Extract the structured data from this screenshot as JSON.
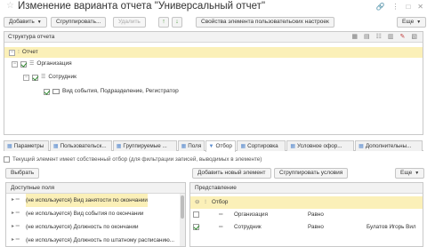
{
  "window": {
    "title": "Изменение варианта отчета \"Универсальный отчет\"",
    "icons": [
      "link-icon",
      "more-icon",
      "maximize-icon",
      "close-icon"
    ]
  },
  "toolbar": {
    "add_label": "Добавить",
    "group_label": "Сгруппировать...",
    "delete_label": "Удалить",
    "up_icon": "↑",
    "down_icon": "↓",
    "user_settings_label": "Свойства элемента пользовательских настроек",
    "more_label": "Еще"
  },
  "structure": {
    "header": "Структура отчета",
    "rows": [
      {
        "label": "Отчет",
        "level": 0,
        "checked": false,
        "selected": true
      },
      {
        "label": "Организация",
        "level": 1,
        "checked": true,
        "selected": false
      },
      {
        "label": "Сотрудник",
        "level": 2,
        "checked": true,
        "selected": false
      },
      {
        "label": "Вид события, Подразделение, Регистратор",
        "level": 3,
        "checked": true,
        "selected": false
      }
    ]
  },
  "tabs": [
    {
      "label": "Параметры",
      "icon": "table-icon",
      "active": false
    },
    {
      "label": "Пользовательск...",
      "icon": "table-icon",
      "active": false
    },
    {
      "label": "Группируемые ...",
      "icon": "table-icon",
      "active": false
    },
    {
      "label": "Поля",
      "icon": "table-icon",
      "active": false
    },
    {
      "label": "Отбор",
      "icon": "filter-icon",
      "active": true
    },
    {
      "label": "Сортировка",
      "icon": "table-icon",
      "active": false
    },
    {
      "label": "Условное офор...",
      "icon": "table-icon",
      "active": false
    },
    {
      "label": "Дополнительны...",
      "icon": "table-icon",
      "active": false
    }
  ],
  "filter": {
    "own_filter_label": "Текущий элемент имеет собственный отбор (для фильтрации записей, выводимых в элементе)",
    "select_label": "Выбрать",
    "add_element_label": "Добавить новый элемент",
    "group_conditions_label": "Сгруппировать условия",
    "more_label": "Еще",
    "available_header": "Доступные поля",
    "available_fields": [
      "(не используется) Вид занятости по окончании",
      "(не используется) Вид события по окончании",
      "(не используется) Должность по окончании",
      "(не используется) Должность по штатному расписанию..."
    ],
    "presentation_header": "Представление",
    "conditions": [
      {
        "field": "Отбор",
        "comparison": "",
        "value": "",
        "group": true
      },
      {
        "field": "Организация",
        "comparison": "Равно",
        "value": "",
        "checked": false
      },
      {
        "field": "Сотрудник",
        "comparison": "Равно",
        "value": "Булатов Игорь Вил",
        "checked": true
      }
    ]
  }
}
